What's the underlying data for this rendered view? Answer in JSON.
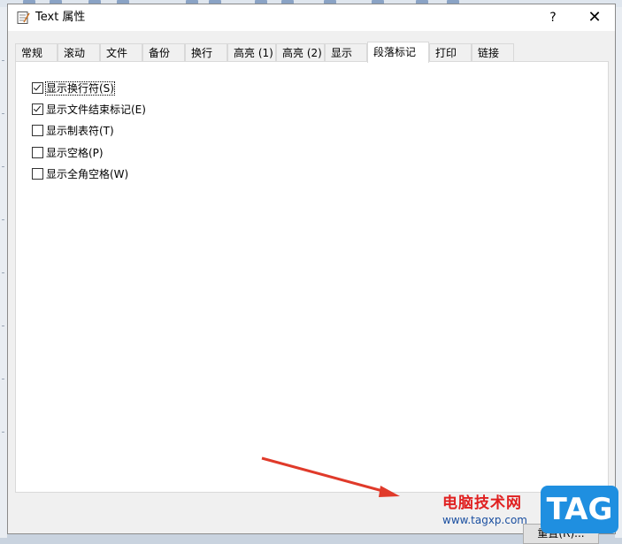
{
  "window": {
    "title": "Text 属性",
    "help_label": "?",
    "close_label": "✕"
  },
  "tabs": [
    {
      "label": "常规",
      "active": false
    },
    {
      "label": "滚动",
      "active": false
    },
    {
      "label": "文件",
      "active": false
    },
    {
      "label": "备份",
      "active": false
    },
    {
      "label": "换行",
      "active": false
    },
    {
      "label": "高亮 (1)",
      "active": false
    },
    {
      "label": "高亮 (2)",
      "active": false
    },
    {
      "label": "显示",
      "active": false
    },
    {
      "label": "段落标记",
      "active": true
    },
    {
      "label": "打印",
      "active": false
    },
    {
      "label": "链接",
      "active": false
    }
  ],
  "options": [
    {
      "label": "显示换行符(S)",
      "checked": true
    },
    {
      "label": "显示文件结束标记(E)",
      "checked": true
    },
    {
      "label": "显示制表符(T)",
      "checked": false
    },
    {
      "label": "显示空格(P)",
      "checked": false
    },
    {
      "label": "显示全角空格(W)",
      "checked": false
    }
  ],
  "reset_button": "重置(R)...",
  "watermark": {
    "site_name": "电脑技术网",
    "url": "www.tagxp.com",
    "logo": "TAG"
  },
  "colors": {
    "arrow": "#e03a2a",
    "logo_bg": "#1f8fe0",
    "watermark_red": "#e02020"
  }
}
